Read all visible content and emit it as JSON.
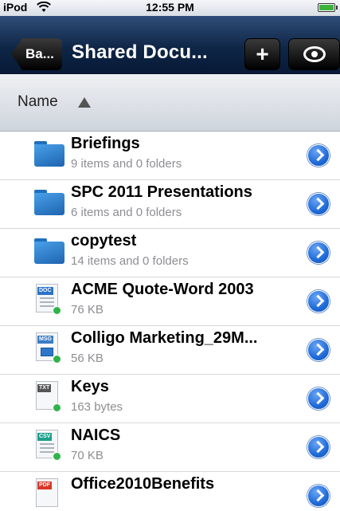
{
  "status_bar": {
    "carrier": "iPod",
    "time": "12:55 PM"
  },
  "nav": {
    "back_label": "Ba...",
    "title": "Shared Docu...",
    "add_label": "+"
  },
  "sort": {
    "label": "Name"
  },
  "items": [
    {
      "name": "Briefings",
      "detail": "9 items and 0 folders",
      "icon": "folder-icon"
    },
    {
      "name": "SPC 2011 Presentations",
      "detail": "6 items and 0 folders",
      "icon": "folder-icon"
    },
    {
      "name": "copytest",
      "detail": "14 items and 0 folders",
      "icon": "folder-icon"
    },
    {
      "name": "ACME Quote-Word 2003",
      "detail": "76 KB",
      "icon": "doc-file-icon",
      "tag": "DOC"
    },
    {
      "name": "Colligo Marketing_29M...",
      "detail": "56 KB",
      "icon": "msg-file-icon",
      "tag": "MSG"
    },
    {
      "name": "Keys",
      "detail": "163 bytes",
      "icon": "txt-file-icon",
      "tag": "TXT"
    },
    {
      "name": "NAICS",
      "detail": "70 KB",
      "icon": "csv-file-icon",
      "tag": "CSV"
    },
    {
      "name": "Office2010Benefits",
      "detail": "",
      "icon": "pdf-file-icon",
      "tag": "PDF"
    }
  ]
}
